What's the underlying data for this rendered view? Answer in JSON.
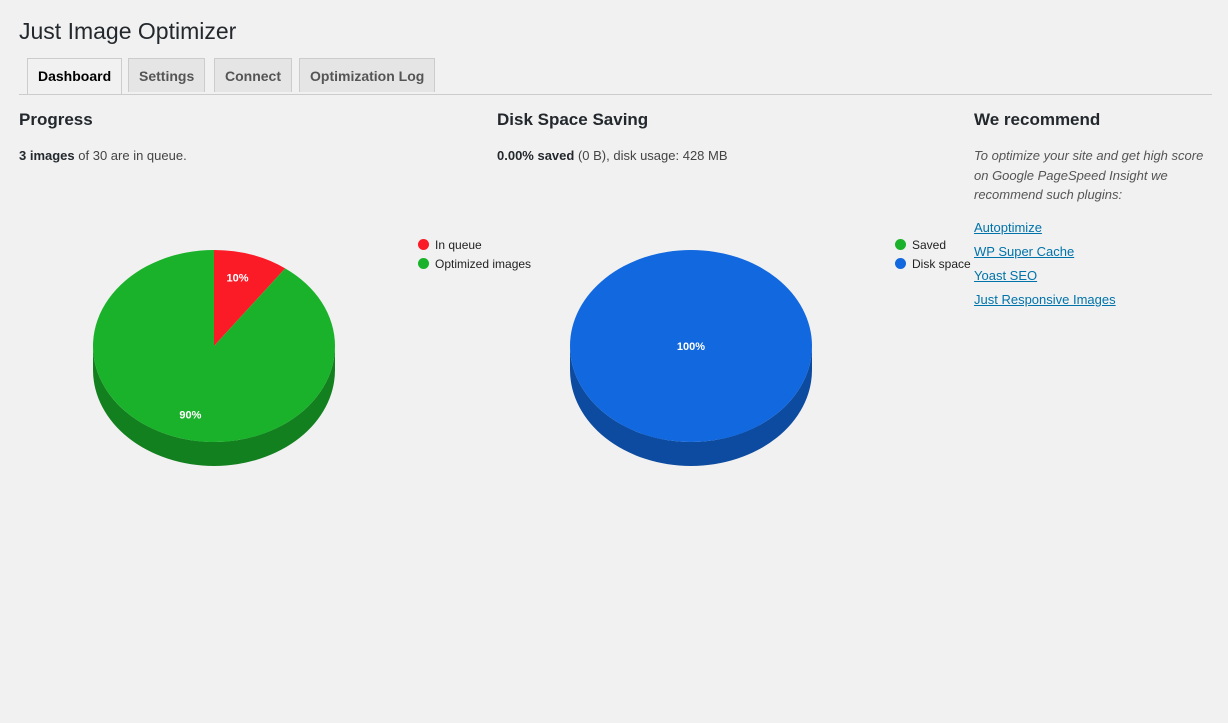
{
  "title": "Just Image Optimizer",
  "tabs": [
    {
      "label": "Dashboard",
      "active": true
    },
    {
      "label": "Settings",
      "active": false
    },
    {
      "label": "Connect",
      "active": false
    },
    {
      "label": "Optimization Log",
      "active": false
    }
  ],
  "progress": {
    "heading": "Progress",
    "status_bold": "3 images",
    "status_rest": " of 30 are in queue."
  },
  "disk": {
    "heading": "Disk Space Saving",
    "status_bold": "0.00% saved",
    "status_rest": " (0 B), disk usage: 428 MB"
  },
  "recommend": {
    "heading": "We recommend",
    "text": "To optimize your site and get high score on Google PageSpeed Insight we recommend such plugins:",
    "links": [
      "Autoptimize",
      "WP Super Cache",
      "Yoast SEO",
      "Just Responsive Images"
    ]
  },
  "chart_data": [
    {
      "type": "pie",
      "is3D": true,
      "legend_position": "right",
      "slices": [
        {
          "label": "In queue",
          "value": 3,
          "percent_label": "10%",
          "color": "#fb1b27"
        },
        {
          "label": "Optimized images",
          "value": 27,
          "percent_label": "90%",
          "color": "#1bb22b"
        }
      ]
    },
    {
      "type": "pie",
      "is3D": true,
      "legend_position": "right",
      "slices": [
        {
          "label": "Saved",
          "value": 0,
          "percent_label": "",
          "color": "#1bb22b"
        },
        {
          "label": "Disk space",
          "value": 100,
          "percent_label": "100%",
          "color": "#1268de"
        }
      ]
    }
  ]
}
